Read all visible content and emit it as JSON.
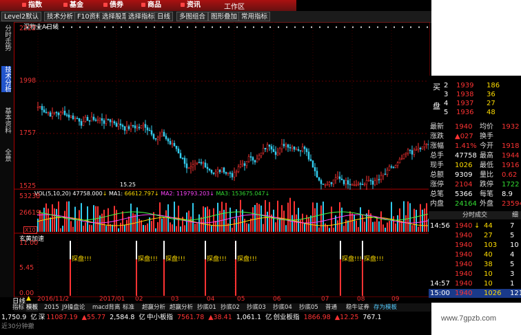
{
  "topnav": {
    "items": [
      "指数",
      "基金",
      "债券",
      "商品",
      "资讯"
    ],
    "workarea": "工作区"
  },
  "toolbar": {
    "items": [
      "Level2默认",
      "技术分析",
      "F10资料",
      "选择股票",
      "选择指标",
      "日线",
      "多图组合",
      "图形叠加",
      "常用指标"
    ]
  },
  "sidebar": {
    "tabs": [
      "分时走势",
      "技术分析",
      "基本资料",
      "全景"
    ]
  },
  "chart": {
    "title": "深物业A日线",
    "price_ticks": [
      "2222",
      "1998",
      "1757",
      "1525"
    ],
    "low_label": "15.25",
    "volume": {
      "header": "VOL(5,10,20)",
      "vol": "47758.000",
      "ma1_label": "MA1:",
      "ma1": "66612.797",
      "ma2_label": "MA2:",
      "ma2": "119793.203",
      "ma3_label": "MA3:",
      "ma3": "153675.047",
      "ticks": [
        "53238",
        "26619",
        "X10"
      ]
    },
    "indicator": {
      "name": "玄黄加速",
      "ticks": [
        "11.00",
        "5.45",
        "0.00"
      ],
      "signal_text": "探盘!!!"
    },
    "time_axis": [
      "日线",
      "2016/11/2",
      "2017/01",
      "02",
      "03",
      "04",
      "05",
      "06",
      "07",
      "08",
      "09"
    ]
  },
  "bottomtabs": [
    "指标",
    "模板",
    "2015",
    "J9操盘论",
    "macd背离",
    "标准",
    "超赢分析",
    "超赢分析",
    "抄底01",
    "抄底02",
    "抄底03",
    "抄底04",
    "抄底05",
    "普通",
    "稳牛证券",
    "存为模板"
  ],
  "statusbar": {
    "row1": [
      {
        "t": "1,750.9",
        "c": "wht"
      },
      {
        "t": "亿",
        "c": "wht"
      },
      {
        "t": "深",
        "c": "wht"
      },
      {
        "t": "11087.19",
        "c": "red"
      },
      {
        "t": "▲55.77",
        "c": "red"
      },
      {
        "t": "2,584.8",
        "c": "wht"
      },
      {
        "t": "亿",
        "c": "wht"
      },
      {
        "t": "中小板指",
        "c": "wht"
      },
      {
        "t": "7561.78",
        "c": "red"
      },
      {
        "t": "▲38.41",
        "c": "red"
      },
      {
        "t": "1,061.1",
        "c": "wht"
      },
      {
        "t": "亿",
        "c": "wht"
      },
      {
        "t": "创业板指",
        "c": "wht"
      },
      {
        "t": "1866.98",
        "c": "red"
      },
      {
        "t": "▲12.25",
        "c": "red"
      },
      {
        "t": "767.1",
        "c": "wht"
      }
    ],
    "row2": "近30分钟撤"
  },
  "right_panel": {
    "bid_label1": "买",
    "bid_label2": "盘",
    "bids": [
      {
        "n": "2",
        "p": "1939",
        "v": "186"
      },
      {
        "n": "3",
        "p": "1938",
        "v": "36"
      },
      {
        "n": "4",
        "p": "1937",
        "v": "27"
      },
      {
        "n": "5",
        "p": "1936",
        "v": "48"
      }
    ],
    "stats": [
      {
        "l": "最新",
        "v": "1940",
        "c": "red",
        "l2": "均价",
        "v2": "1932",
        "c2": "red"
      },
      {
        "l": "涨跌",
        "v": "▲027",
        "c": "red",
        "l2": "换手",
        "v2": "",
        "c2": "red"
      },
      {
        "l": "涨幅",
        "v": "1.41%",
        "c": "red",
        "l2": "今开",
        "v2": "1918",
        "c2": "red"
      },
      {
        "l": "总手",
        "v": "47758",
        "c": "wht",
        "l2": "最高",
        "v2": "1944",
        "c2": "red"
      },
      {
        "l": "现手",
        "v": "1026",
        "c": "yel",
        "l2": "最低",
        "v2": "1916",
        "c2": "red"
      },
      {
        "l": "总额",
        "v": "9309",
        "c": "wht",
        "l2": "量比",
        "v2": "0.62",
        "c2": "red"
      },
      {
        "l": "涨停",
        "v": "2104",
        "c": "red",
        "l2": "跌停",
        "v2": "1722",
        "c2": "grn"
      },
      {
        "l": "总笔",
        "v": "5366",
        "c": "wht",
        "l2": "每笔",
        "v2": "8.9",
        "c2": "wht"
      },
      {
        "l": "内盘",
        "v": "24164",
        "c": "grn",
        "l2": "外盘",
        "v2": "23594",
        "c2": "red"
      }
    ],
    "ticks_header": "分时成交",
    "ticks_header_btn": "细",
    "ticks": [
      {
        "t": "14:56",
        "p": "1940",
        "arrow": "↓",
        "v": "44",
        "n": "7"
      },
      {
        "t": "",
        "p": "1940",
        "arrow": "",
        "v": "27",
        "n": "5"
      },
      {
        "t": "",
        "p": "1940",
        "arrow": "",
        "v": "103",
        "n": "10"
      },
      {
        "t": "",
        "p": "1940",
        "arrow": "",
        "v": "40",
        "n": "4"
      },
      {
        "t": "",
        "p": "1940",
        "arrow": "",
        "v": "38",
        "n": "5"
      },
      {
        "t": "",
        "p": "1940",
        "arrow": "",
        "v": "10",
        "n": "3"
      },
      {
        "t": "14:57",
        "p": "1940",
        "arrow": "",
        "v": "10",
        "n": "1"
      },
      {
        "t": "15:00",
        "p": "1940",
        "arrow": "",
        "v": "1026",
        "n": "121"
      }
    ]
  },
  "watermark": "www.7gpzb.com",
  "colors": {
    "up": "#ff3333",
    "down": "#33dd33",
    "ma_yellow": "#ffdd00",
    "ma_pink": "#ff44ff",
    "ma_green": "#44ff44",
    "border": "#aa0000"
  }
}
